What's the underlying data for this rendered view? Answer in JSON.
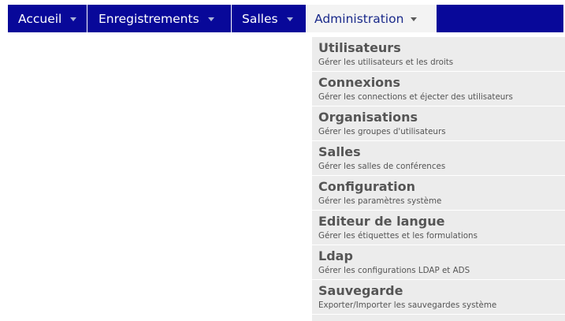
{
  "menubar": {
    "items": [
      {
        "label": "Accueil"
      },
      {
        "label": "Enregistrements"
      },
      {
        "label": "Salles"
      },
      {
        "label": "Administration"
      }
    ]
  },
  "dropdown": {
    "items": [
      {
        "title": "Utilisateurs",
        "desc": "Gérer les utilisateurs et les droits"
      },
      {
        "title": "Connexions",
        "desc": "Gérer les connections et éjecter des utilisateurs"
      },
      {
        "title": "Organisations",
        "desc": "Gérer les groupes d'utilisateurs"
      },
      {
        "title": "Salles",
        "desc": "Gérer les salles de conférences"
      },
      {
        "title": "Configuration",
        "desc": "Gérer les paramètres système"
      },
      {
        "title": "Editeur de langue",
        "desc": "Gérer les étiquettes et les formulations"
      },
      {
        "title": "Ldap",
        "desc": "Gérer les configurations LDAP et ADS"
      },
      {
        "title": "Sauvegarde",
        "desc": "Exporter/Importer les sauvegardes système"
      }
    ]
  },
  "colors": {
    "menubar_bg": "#080899",
    "active_tab_bg": "#f3f3f3",
    "dropdown_bg": "#ececec",
    "text_gray": "#555555"
  },
  "icons": {
    "menu_arrow": "caret-down-icon"
  }
}
